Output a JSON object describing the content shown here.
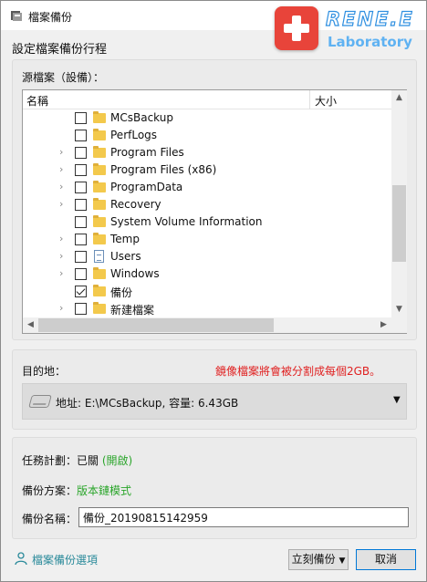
{
  "window": {
    "title": "檔案備份"
  },
  "logo": {
    "brand": "RENE.E",
    "sub": "Laboratory"
  },
  "subtitle": "設定檔案備份行程",
  "source": {
    "label": "源檔案（設備）：",
    "columns": {
      "name": "名稱",
      "size": "大小"
    },
    "items": [
      {
        "label": "MCsBackup",
        "icon": "folder-icon",
        "checked": false,
        "expandable": false
      },
      {
        "label": "PerfLogs",
        "icon": "folder-icon",
        "checked": false,
        "expandable": false
      },
      {
        "label": "Program Files",
        "icon": "folder-icon",
        "checked": false,
        "expandable": true
      },
      {
        "label": "Program Files (x86)",
        "icon": "folder-icon",
        "checked": false,
        "expandable": true
      },
      {
        "label": "ProgramData",
        "icon": "folder-icon",
        "checked": false,
        "expandable": true
      },
      {
        "label": "Recovery",
        "icon": "folder-icon",
        "checked": false,
        "expandable": true
      },
      {
        "label": "System Volume Information",
        "icon": "folder-icon",
        "checked": false,
        "expandable": false
      },
      {
        "label": "Temp",
        "icon": "folder-icon",
        "checked": false,
        "expandable": true
      },
      {
        "label": "Users",
        "icon": "document-icon",
        "checked": false,
        "expandable": true
      },
      {
        "label": "Windows",
        "icon": "folder-icon",
        "checked": false,
        "expandable": true
      },
      {
        "label": "備份",
        "icon": "folder-icon",
        "checked": true,
        "expandable": false
      },
      {
        "label": "新建檔案",
        "icon": "folder-icon",
        "checked": false,
        "expandable": true
      }
    ]
  },
  "destination": {
    "label": "目的地：",
    "warning": "鏡像檔案將會被分割成每個2GB。",
    "value": "地址: E:\\MCsBackup, 容量: 6.43GB"
  },
  "task": {
    "schedule_label": "任務計劃：已關",
    "schedule_link": "(開啟)",
    "scheme_label": "備份方案：",
    "scheme_value": "版本鏈模式",
    "name_label": "備份名稱：",
    "name_value": "備份_20190815142959"
  },
  "footer": {
    "options_link": "檔案備份選項",
    "backup_button": "立刻備份",
    "cancel_button": "取消"
  },
  "colors": {
    "warning": "#e02020",
    "link_green": "#2aa52a",
    "logo_red": "#e8443a",
    "logo_blue": "#2f8fe0"
  }
}
